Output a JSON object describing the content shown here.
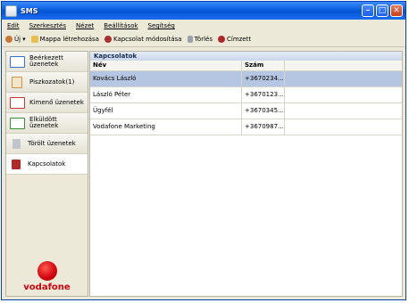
{
  "window": {
    "title": "SMS",
    "accent": "#0a5fe0"
  },
  "menu": [
    "Edit",
    "Szerkesztés",
    "Nézet",
    "Beállítások",
    "Segítség"
  ],
  "toolbar": {
    "new_label": "Új",
    "new_folder_label": "Mappa létrehozása",
    "edit_contact_label": "Kapcsolat módosítása",
    "delete_label": "Törlés",
    "recipient_label": "Címzett"
  },
  "sidebar": {
    "items": [
      {
        "label": "Beérkezett üzenetek",
        "icon": "inbox-icon",
        "color": "#3a6fc6"
      },
      {
        "label": "Piszkozatok(1)",
        "icon": "drafts-icon",
        "color": "#c8934a"
      },
      {
        "label": "Kimenő üzenetek",
        "icon": "outbox-icon",
        "color": "#c83a3a"
      },
      {
        "label": "Elküldött üzenetek",
        "icon": "sent-icon",
        "color": "#3a8c3a"
      },
      {
        "label": "Törölt üzenetek",
        "icon": "trash-icon",
        "color": "#8a8a8a"
      },
      {
        "label": "Kapcsolatok",
        "icon": "contacts-icon",
        "color": "#b02a2a"
      }
    ],
    "active_index": 5,
    "brand": "vodafone",
    "brand_color": "#d0000e"
  },
  "contacts": {
    "title": "Kapcsolatok",
    "columns": [
      "Név",
      "Szám"
    ],
    "rows": [
      {
        "name": "Kovács László",
        "number": "+3670234...",
        "selected": true
      },
      {
        "name": "László Péter",
        "number": "+3670123...",
        "selected": false
      },
      {
        "name": "Ügyfél",
        "number": "+3670345...",
        "selected": false
      },
      {
        "name": "Vodafone Marketing",
        "number": "+3670987...",
        "selected": false
      }
    ],
    "selected_color": "#b4c6e1"
  }
}
